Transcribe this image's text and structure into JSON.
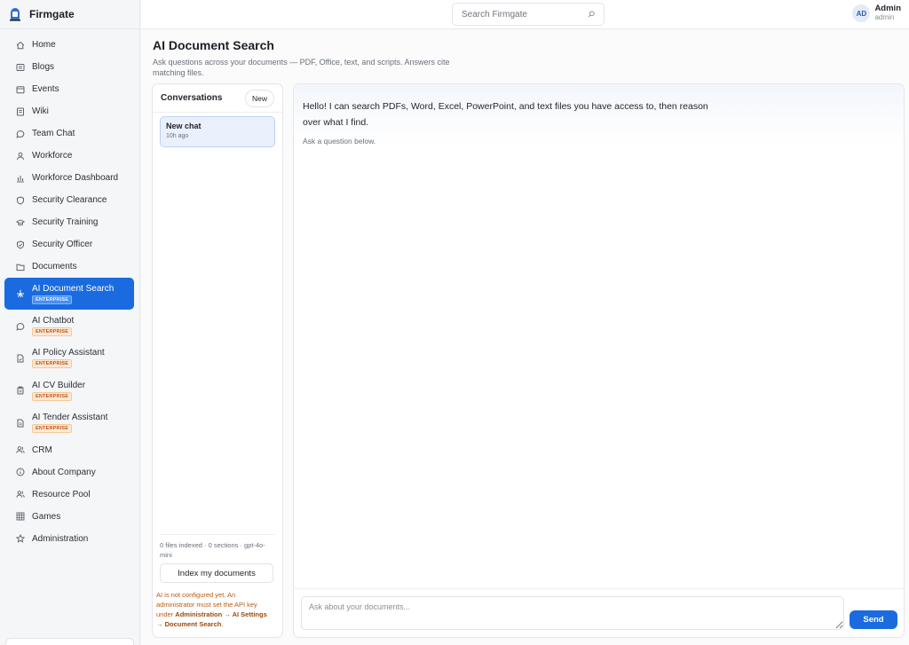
{
  "brand": {
    "name": "Firmgate"
  },
  "topbar": {
    "search_placeholder": "Search Firmgate",
    "user": {
      "initials": "AD",
      "name": "Admin",
      "role": "admin"
    }
  },
  "sidebar": {
    "items": [
      {
        "label": "Home",
        "icon": "home-icon"
      },
      {
        "label": "Blogs",
        "icon": "blog-icon"
      },
      {
        "label": "Events",
        "icon": "calendar-icon"
      },
      {
        "label": "Wiki",
        "icon": "book-icon"
      },
      {
        "label": "Team Chat",
        "icon": "chat-bubble-icon"
      },
      {
        "label": "Workforce",
        "icon": "user-icon"
      },
      {
        "label": "Workforce Dashboard",
        "icon": "bar-chart-icon"
      },
      {
        "label": "Security Clearance",
        "icon": "shield-icon"
      },
      {
        "label": "Security Training",
        "icon": "graduation-cap-icon"
      },
      {
        "label": "Security Officer",
        "icon": "shield-check-icon"
      },
      {
        "label": "Documents",
        "icon": "folder-icon"
      },
      {
        "label": "AI Document Search",
        "icon": "sparkle-icon",
        "badge": "ENTERPRISE",
        "active": true
      },
      {
        "label": "AI Chatbot",
        "icon": "chat-bubble-icon",
        "badge": "ENTERPRISE"
      },
      {
        "label": "AI Policy Assistant",
        "icon": "file-icon",
        "badge": "ENTERPRISE"
      },
      {
        "label": "AI CV Builder",
        "icon": "clipboard-icon",
        "badge": "ENTERPRISE"
      },
      {
        "label": "AI Tender Assistant",
        "icon": "file-list-icon",
        "badge": "ENTERPRISE"
      },
      {
        "label": "CRM",
        "icon": "users-icon"
      },
      {
        "label": "About Company",
        "icon": "info-icon"
      },
      {
        "label": "Resource Pool",
        "icon": "users-icon"
      },
      {
        "label": "Games",
        "icon": "grid-icon"
      },
      {
        "label": "Administration",
        "icon": "star-icon"
      }
    ]
  },
  "page": {
    "title": "AI Document Search",
    "subtitle": "Ask questions across your documents — PDF, Office, text, and scripts. Answers cite matching files."
  },
  "conversations": {
    "title": "Conversations",
    "new_label": "New",
    "items": [
      {
        "name": "New chat",
        "time": "10h ago"
      }
    ],
    "stats": "0 files indexed · 0 sections · gpt-4o-mini",
    "index_label": "Index my documents",
    "warning_prefix": "AI is not configured yet. An administrator must set the API key under ",
    "warning_path": "Administration → AI Settings → Document Search",
    "warning_suffix": "."
  },
  "chat": {
    "greeting": "Hello! I can search PDFs, Word, Excel, PowerPoint, and text files you have access to, then reason over what I find.",
    "hint": "Ask a question below.",
    "input_placeholder": "Ask about your documents...",
    "send_label": "Send"
  },
  "colors": {
    "accent": "#1a6be0",
    "warning": "#b65b12",
    "badge_orange": "#c0581a"
  }
}
